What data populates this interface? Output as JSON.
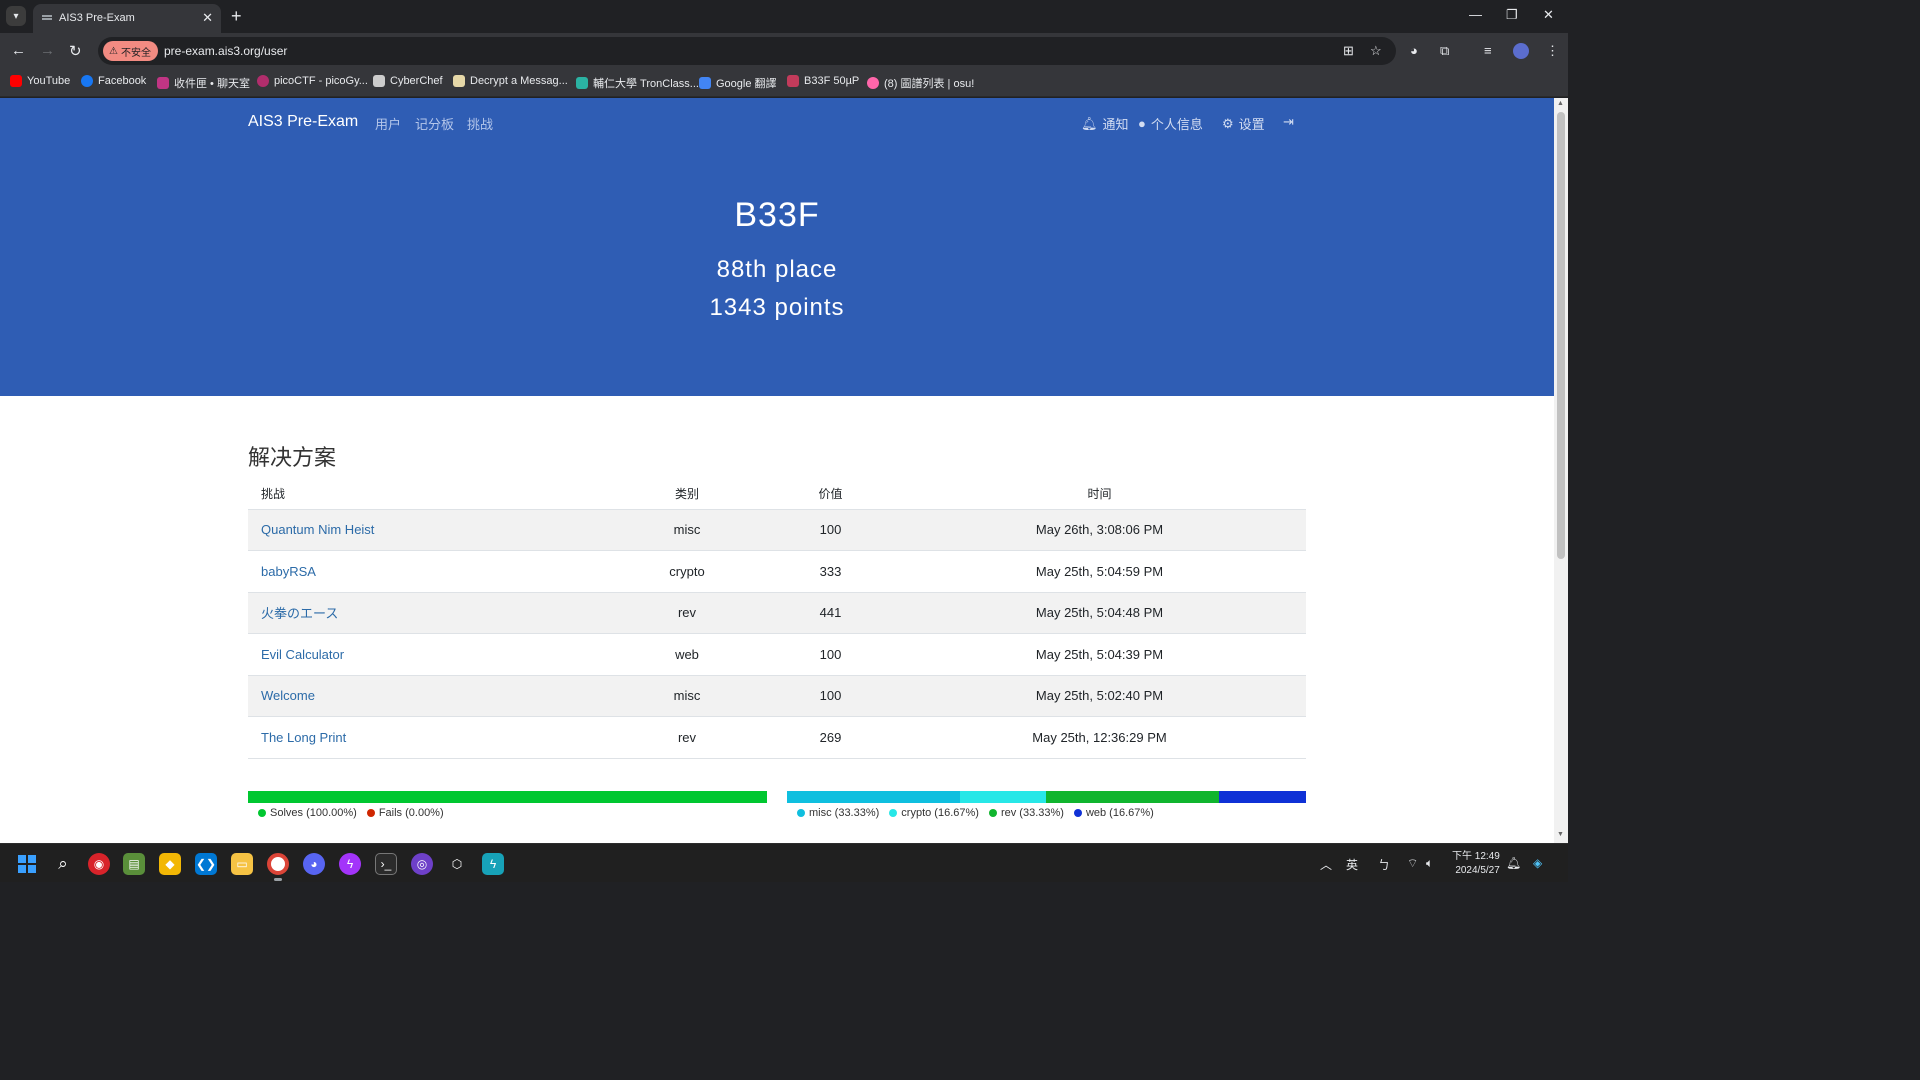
{
  "browser": {
    "tab_title": "AIS3 Pre-Exam",
    "tab_close": "✕",
    "new_tab": "+",
    "insecure_label": "不安全",
    "url": "pre-exam.ais3.org/user",
    "bookmarks": [
      {
        "label": "YouTube",
        "color": "#ff0000"
      },
      {
        "label": "Facebook",
        "color": "#1877f2"
      },
      {
        "label": "收件匣 • 聊天室",
        "color": "#c13584"
      },
      {
        "label": "picoCTF - picoGy...",
        "color": "#b12d6c"
      },
      {
        "label": "CyberChef",
        "color": "#cccccc"
      },
      {
        "label": "Decrypt a Messag...",
        "color": "#e6d8a8"
      },
      {
        "label": "輔仁大學 TronClass...",
        "color": "#2bb3a3"
      },
      {
        "label": "Google 翻譯",
        "color": "#4285f4"
      },
      {
        "label": "B33F 50µP",
        "color": "#c23b5b"
      },
      {
        "label": "(8) 圖譜列表 | osu!",
        "color": "#ff66aa"
      }
    ]
  },
  "site": {
    "brand": "AIS3 Pre-Exam",
    "nav": [
      "用户",
      "记分板",
      "挑战"
    ],
    "nav_right": [
      "通知",
      "个人信息",
      "设置"
    ]
  },
  "profile": {
    "name": "B33F",
    "place": "88th place",
    "points": "1343 points"
  },
  "solves": {
    "title": "解决方案",
    "headers": [
      "挑战",
      "类别",
      "价值",
      "时间"
    ],
    "rows": [
      {
        "challenge": "Quantum Nim Heist",
        "category": "misc",
        "value": "100",
        "time": "May 26th, 3:08:06 PM"
      },
      {
        "challenge": "babyRSA",
        "category": "crypto",
        "value": "333",
        "time": "May 25th, 5:04:59 PM"
      },
      {
        "challenge": "火拳のエース",
        "category": "rev",
        "value": "441",
        "time": "May 25th, 5:04:48 PM"
      },
      {
        "challenge": "Evil Calculator",
        "category": "web",
        "value": "100",
        "time": "May 25th, 5:04:39 PM"
      },
      {
        "challenge": "Welcome",
        "category": "misc",
        "value": "100",
        "time": "May 25th, 5:02:40 PM"
      },
      {
        "challenge": "The Long Print",
        "category": "rev",
        "value": "269",
        "time": "May 25th, 12:36:29 PM"
      }
    ]
  },
  "solve_ratio": {
    "legend": [
      "Solves (100.00%)",
      "Fails (0.00%)"
    ],
    "colors": [
      "#00c730",
      "#cf2600"
    ],
    "values": [
      1.0,
      0.0
    ]
  },
  "category_breakdown": {
    "legend": [
      "misc (33.33%)",
      "crypto (16.67%)",
      "rev (33.33%)",
      "web (16.67%)"
    ],
    "colors": [
      "#0fbfdf",
      "#27e7e7",
      "#10b52e",
      "#0f31d6"
    ],
    "values": [
      0.3333,
      0.1667,
      0.3333,
      0.1667
    ]
  },
  "taskbar": {
    "tray_ime": "英",
    "clock_time": "下午 12:49",
    "clock_date": "2024/5/27"
  }
}
